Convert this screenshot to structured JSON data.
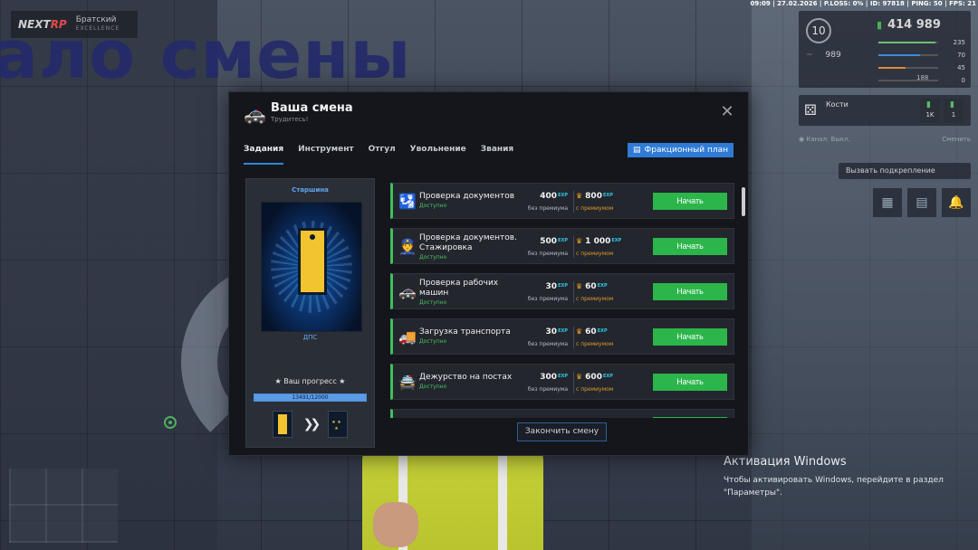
{
  "status_bar": "09:09 | 27.02.2026 | P.LOSS: 0% | ID: 97818 | PING: 50 | FPS: 21",
  "background": {
    "sign_text": "ало смены"
  },
  "logo": {
    "brand_left": "NEXT",
    "brand_right": "RP",
    "server": "Братский",
    "server_tag": "EXCELLENCE"
  },
  "hud": {
    "level": "10",
    "money": "414 989",
    "stats": [
      {
        "value": "235",
        "color": "#6fbf73",
        "fill": 0.95
      },
      {
        "value": "70",
        "color": "#3a8de0",
        "fill": 0.7
      },
      {
        "value": "45",
        "color": "#e08a3a",
        "fill": 0.45
      },
      {
        "value": "0",
        "color": "#888888",
        "fill": 0.0
      }
    ],
    "wave_value": "989",
    "extra_value": "188",
    "task_title": "Кости",
    "task_badges": [
      "1K",
      "1"
    ],
    "channel_label": "Канал: Выкл.",
    "channel_action": "Сменить",
    "backup_label": "Вызвать подкрепление"
  },
  "dialog": {
    "title": "Ваша смена",
    "subtitle": "Трудитесь!",
    "tabs": [
      "Задания",
      "Инструмент",
      "Отгул",
      "Увольнение",
      "Звания"
    ],
    "faction_button": "Фракционный план",
    "finish_button": "Закончить смену"
  },
  "rank": {
    "title": "Старшина",
    "department": "ДПС",
    "progress_label": "★ Ваш прогресс ★",
    "progress_text": "13491/12000",
    "progress_fill": 1.0
  },
  "exp_label": "EXP",
  "reward_base_label": "без премиума",
  "reward_premium_label": "с премиумом",
  "start_label": "Начать",
  "tasks": [
    {
      "name": "Проверка документов",
      "status": "Доступно",
      "base": "400",
      "premium": "800",
      "icon": "document-check-icon",
      "lines": 1
    },
    {
      "name": "Проверка документов. Стажировка",
      "status": "Доступно",
      "base": "500",
      "premium": "1 000",
      "icon": "officers-icon",
      "lines": 2
    },
    {
      "name": "Проверка рабочих машин",
      "status": "Доступно",
      "base": "30",
      "premium": "60",
      "icon": "police-car-icon",
      "lines": 2
    },
    {
      "name": "Загрузка транспорта",
      "status": "Доступно",
      "base": "30",
      "premium": "60",
      "icon": "car-loading-icon",
      "lines": 1
    },
    {
      "name": "Дежурство на постах",
      "status": "Доступно",
      "base": "300",
      "premium": "600",
      "icon": "post-duty-icon",
      "lines": 1
    }
  ],
  "windows_activation": {
    "title": "Активация Windows",
    "line1": "Чтобы активировать Windows, перейдите в раздел",
    "line2": "\"Параметры\"."
  }
}
